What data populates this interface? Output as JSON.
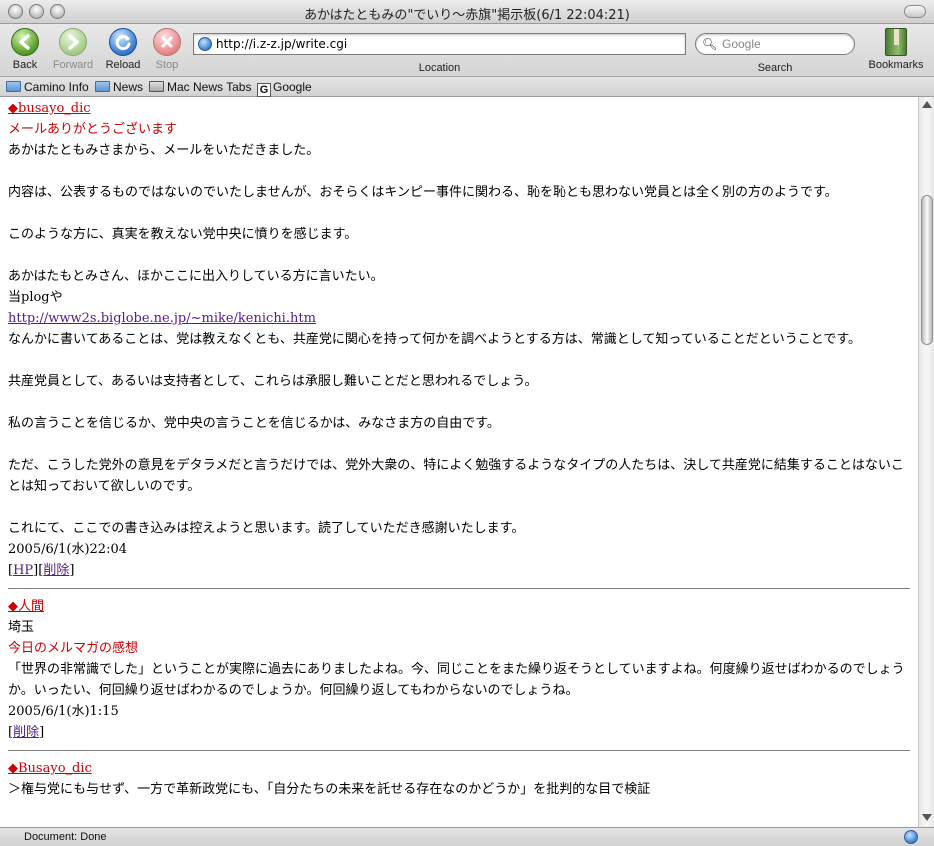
{
  "window": {
    "title": "あかはたともみの\"でいり〜赤旗\"掲示板(6/1 22:04:21)"
  },
  "toolbar": {
    "back_label": "Back",
    "forward_label": "Forward",
    "reload_label": "Reload",
    "stop_label": "Stop",
    "location_label": "Location",
    "url": "http://i.z-z.jp/write.cgi",
    "search_label": "Search",
    "search_placeholder": "Google",
    "bookmarks_label": "Bookmarks"
  },
  "bookmarks_bar": [
    {
      "label": "Camino Info",
      "icon": "folder-icon"
    },
    {
      "label": "News",
      "icon": "folder-icon"
    },
    {
      "label": "Mac News Tabs",
      "icon": "tabs-icon"
    },
    {
      "label": "Google",
      "icon": "google-icon"
    }
  ],
  "posts": [
    {
      "name": "◆busayo_dic",
      "subject": "メールありがとうございます",
      "lines": {
        "l1": "あかはたともみさまから、メールをいただきました。",
        "l2": "内容は、公表するものではないのでいたしませんが、おそらくはキンピー事件に関わる、恥を恥とも思わない党員とは全く別の方のようです。",
        "l3": "このような方に、真実を教えない党中央に憤りを感じます。",
        "l4": "あかはたもとみさん、ほかここに出入りしている方に言いたい。",
        "l5": "当plogや",
        "link": "http://www2s.biglobe.ne.jp/~mike/kenichi.htm",
        "l6": "なんかに書いてあることは、党は教えなくとも、共産党に関心を持って何かを調べようとする方は、常識として知っていることだということです。",
        "l7": "共産党員として、あるいは支持者として、これらは承服し難いことだと思われるでしょう。",
        "l8": "私の言うことを信じるか、党中央の言うことを信じるかは、みなさま方の自由です。",
        "l9": "ただ、こうした党外の意見をデタラメだと言うだけでは、党外大衆の、特によく勉強するようなタイプの人たちは、決して共産党に結集することはないことは知っておいて欲しいのです。",
        "l10": "これにて、ここでの書き込みは控えようと思います。読了していただき感謝いたします。"
      },
      "date": "2005/6/1(水)22:04",
      "actions": {
        "hp": "HP",
        "delete": "削除"
      }
    },
    {
      "name": "◆人間",
      "location": "埼玉",
      "subject": "今日のメルマガの感想",
      "body": "「世界の非常識でした」ということが実際に過去にありましたよね。今、同じことをまた繰り返そうとしていますよね。何度繰り返せばわかるのでしょうか。いったい、何回繰り返せばわかるのでしょうか。何回繰り返してもわからないのでしょうね。",
      "date": "2005/6/1(水)1:15",
      "actions": {
        "delete": "削除"
      }
    },
    {
      "name": "◆Busayo_dic",
      "body": "＞権与党にも与せず、一方で革新政党にも、「自分たちの未来を託せる存在なのかどうか」を批判的な目で検証"
    }
  ],
  "status": {
    "text": "Document: Done"
  },
  "colors": {
    "poster_name": "#cc0000",
    "subject": "#cc0000",
    "link_visited": "#551a8b"
  }
}
